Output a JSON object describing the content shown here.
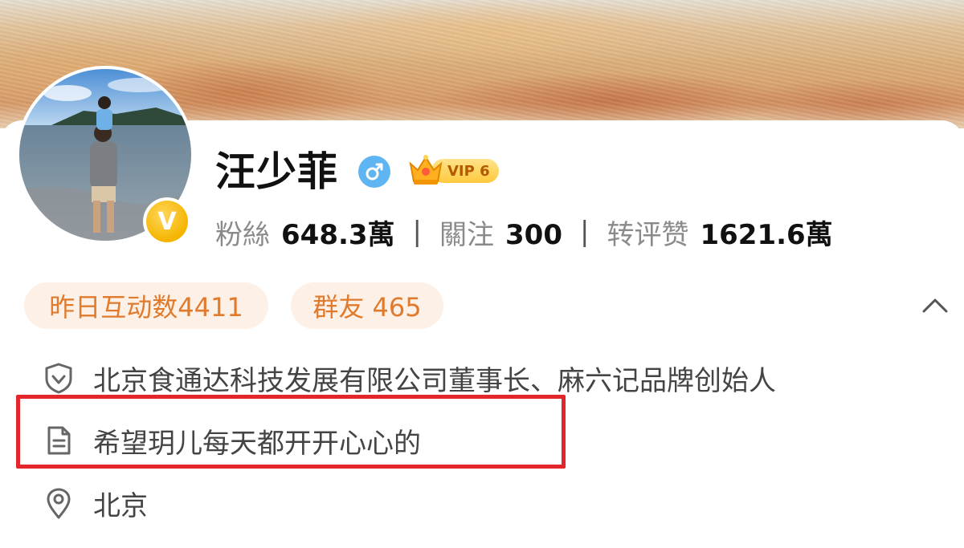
{
  "profile": {
    "name": "汪少菲",
    "gender_icon": "male-icon",
    "vip_label": "VIP 6",
    "verified_badge": "V",
    "stats": [
      {
        "label": "粉絲",
        "value": "648.3萬"
      },
      {
        "label": "關注",
        "value": "300"
      },
      {
        "label": "转评赞",
        "value": "1621.6萬"
      }
    ],
    "separator": "|"
  },
  "chips": {
    "interaction": "昨日互动数4411",
    "fan_group": "群友 465"
  },
  "info": {
    "title": "北京食通达科技发展有限公司董事长、麻六记品牌创始人",
    "bio": "希望玥儿每天都开开心心的",
    "location": "北京"
  },
  "colors": {
    "accent_orange": "#e07a2c",
    "chip_bg": "#fdf0e6",
    "highlight_red": "#e3262c",
    "gender_blue": "#5fb4f2",
    "verified_gold": "#f5b400"
  }
}
